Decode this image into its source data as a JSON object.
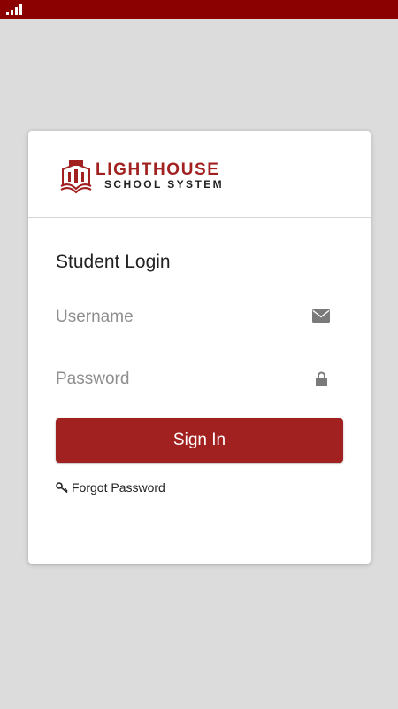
{
  "status_bar": {
    "signal_icon": "signal-bars-icon"
  },
  "brand": {
    "name_line1": "LIGHTHOUSE",
    "name_line2": "SCHOOL SYSTEM",
    "color": "#a12121"
  },
  "login": {
    "title": "Student Login",
    "username": {
      "placeholder": "Username",
      "value": "",
      "icon": "mail-icon"
    },
    "password": {
      "placeholder": "Password",
      "value": "",
      "icon": "lock-icon"
    },
    "signin_label": "Sign In",
    "forgot_label": "Forgot Password",
    "forgot_icon": "key-icon"
  },
  "colors": {
    "status_bar": "#8b0000",
    "button": "#a12121",
    "background": "#dcdcdc"
  }
}
